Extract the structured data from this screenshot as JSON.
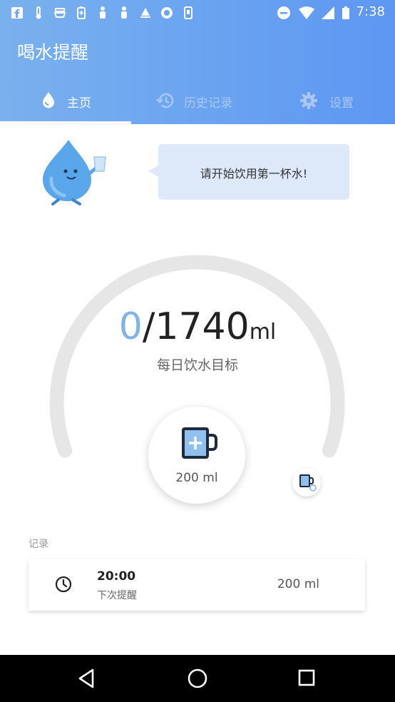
{
  "status_bar": {
    "time": "7:38",
    "left_icons": [
      "facebook-icon",
      "thermometer-icon",
      "boat-icon",
      "battery-saver-icon",
      "person-icon",
      "person-icon",
      "sailboat-icon",
      "sync-icon",
      "phone-icon"
    ],
    "right_icons": [
      "do-not-disturb-icon",
      "wifi-icon",
      "signal-icon",
      "battery-icon"
    ]
  },
  "header": {
    "title": "喝水提醒",
    "tabs": [
      {
        "label": "主页",
        "icon": "water-drop-icon",
        "active": true
      },
      {
        "label": "历史记录",
        "icon": "history-icon",
        "active": false
      },
      {
        "label": "设置",
        "icon": "gear-icon",
        "active": false
      }
    ]
  },
  "main": {
    "mascot": "water-drop-mascot",
    "bubble_text": "请开始饮用第一杯水!",
    "progress": {
      "current": "0",
      "separator": "/",
      "goal": "1740",
      "unit": "ml",
      "fraction": 0
    },
    "goal_label": "每日饮水目标",
    "cup_button_label": "200 ml",
    "switch_cup_icon": "switch-cup-icon"
  },
  "records": {
    "title": "记录",
    "items": [
      {
        "time": "20:00",
        "subtitle": "下次提醒",
        "amount": "200 ml"
      }
    ]
  },
  "colors": {
    "header_start": "#79b1ee",
    "header_end": "#5d97f2",
    "accent": "#7fb2ec",
    "gauge_track": "#e6e6e6"
  }
}
